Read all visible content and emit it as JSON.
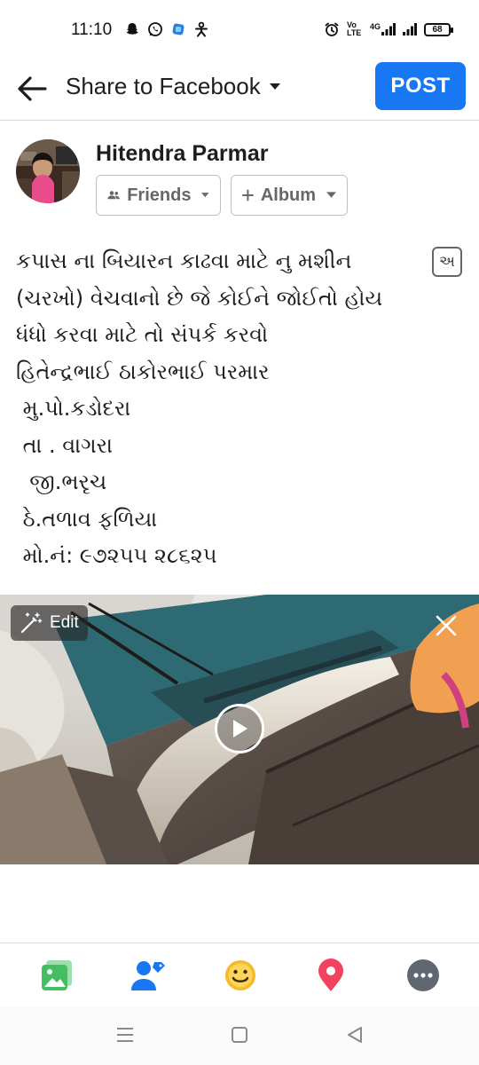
{
  "status_bar": {
    "time": "11:10",
    "left_icons": [
      "snapchat-icon",
      "whatsapp-icon",
      "app-icon",
      "accessibility-icon"
    ],
    "right_icons": [
      "alarm-icon",
      "volte-icon",
      "4g-signal-icon",
      "signal-icon",
      "battery-icon"
    ],
    "volte_label": "Vo LTE",
    "network_label": "4G",
    "battery_level": "68"
  },
  "header": {
    "title": "Share to Facebook",
    "post_label": "POST",
    "accent_color": "#1877f2"
  },
  "composer": {
    "user_name": "Hitendra Parmar",
    "audience_label": "Friends",
    "album_label": "Album",
    "transliterate_glyph": "અ"
  },
  "post": {
    "lines": [
      "કપાસ ના બિયારન કાઢવા માટે નુ મશીન",
      "(ચરખો) વેચવાનો છે જે કોઈને જોઈતો હોય",
      "ધંધો કરવા માટે તો સંપર્ક કરવો",
      "હિતેન્દ્રભાઈ ઠાકોરભાઈ પરમાર",
      " મુ.પો.કડોદરા",
      " તા . વાગરા",
      "  જી.ભરૃચ",
      " ઠે.તળાવ ફળિયા",
      " મો.નં: ૯૭૨૫૫ ૨૮૬૨૫"
    ]
  },
  "media": {
    "edit_label": "Edit"
  },
  "toolbar": {
    "items": [
      "photo-icon",
      "tag-people-icon",
      "feeling-icon",
      "location-icon",
      "more-icon"
    ],
    "colors": {
      "photo": "#45bd62",
      "tag": "#1877f2",
      "feeling": "#f7b928",
      "location": "#f3425f",
      "more": "#606770"
    }
  },
  "nav_bar": {
    "items": [
      "menu-icon",
      "home-icon",
      "back-triangle-icon"
    ]
  }
}
